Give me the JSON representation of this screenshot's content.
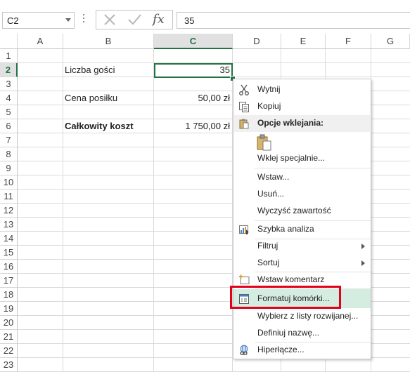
{
  "formula_bar": {
    "name_box": "C2",
    "formula_value": "35",
    "fx_label": "fx"
  },
  "columns": [
    "A",
    "B",
    "C",
    "D",
    "E",
    "F",
    "G"
  ],
  "selected_column": "C",
  "rows": [
    "1",
    "2",
    "3",
    "4",
    "5",
    "6",
    "7",
    "8",
    "9",
    "10",
    "11",
    "12",
    "13",
    "14",
    "15",
    "16",
    "17",
    "18",
    "19",
    "20",
    "21",
    "22",
    "23"
  ],
  "selected_row": "2",
  "cells": {
    "b2": "Liczba gości",
    "c2": "35",
    "b4": "Cena posiłku",
    "c4": "50,00 zł",
    "b6": "Całkowity koszt",
    "c6": "1 750,00 zł"
  },
  "context_menu": {
    "cut": "Wytnij",
    "copy": "Kopiuj",
    "paste_options_header": "Opcje wklejania:",
    "paste_special": "Wklej specjalnie...",
    "insert": "Wstaw...",
    "delete": "Usuń...",
    "clear_contents": "Wyczyść zawartość",
    "quick_analysis": "Szybka analiza",
    "filter": "Filtruj",
    "sort": "Sortuj",
    "insert_comment": "Wstaw komentarz",
    "format_cells": "Formatuj komórki...",
    "pick_from_list": "Wybierz z listy rozwijanej...",
    "define_name": "Definiuj nazwę...",
    "hyperlink": "Hiperłącze..."
  },
  "colors": {
    "excel_green": "#217346",
    "highlight": "#d5ede0",
    "callout_red": "#e2001a"
  }
}
